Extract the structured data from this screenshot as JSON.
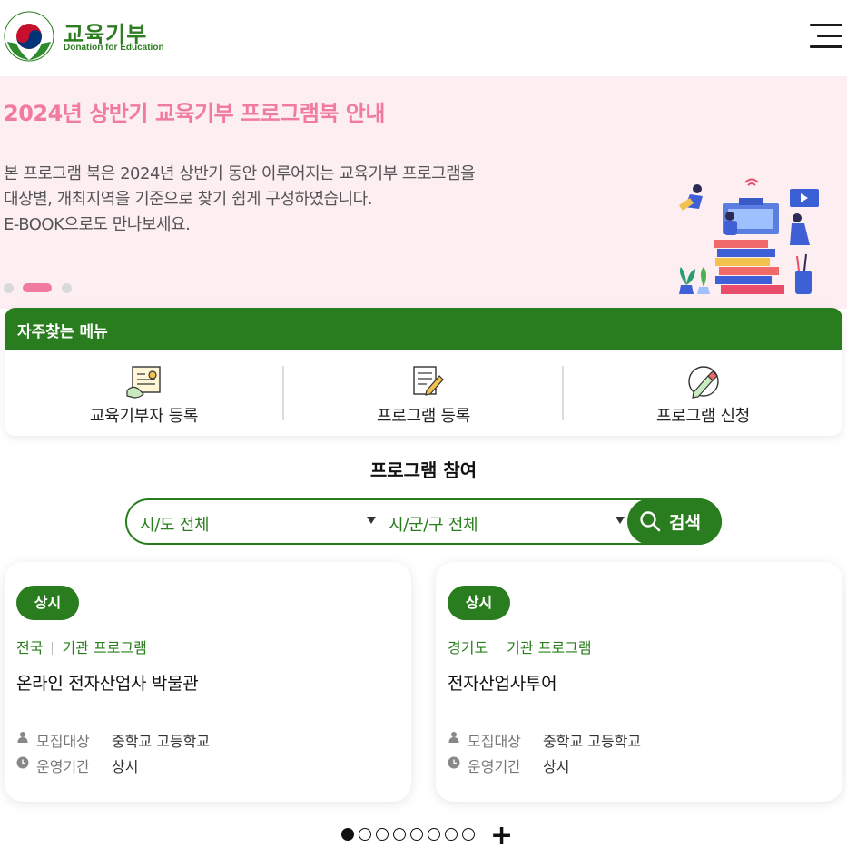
{
  "header": {
    "title": "교육기부",
    "subtitle": "Donation for Education",
    "logo_ring_text": "Donation for Education",
    "menu_icon": "hamburger-menu-icon"
  },
  "banner": {
    "title": "2024년 상반기 교육기부 프로그램북 안내",
    "description": [
      "본 프로그램 북은 2024년 상반기 동안 이루어지는 교육기부 프로그램을",
      "대상별, 개최지역을 기준으로 찾기 쉽게 구성하였습니다.",
      "E-BOOK으로도 만나보세요."
    ],
    "slide_count": 3,
    "active_slide": 2,
    "colors": {
      "background": "#fdeef1",
      "title": "#f07aa0",
      "dot_active": "#f07aa0"
    }
  },
  "quick_menu": {
    "title": "자주찾는 메뉴",
    "items": [
      {
        "label": "교육기부자 등록",
        "icon": "id-card-hand-icon"
      },
      {
        "label": "프로그램 등록",
        "icon": "document-pencil-icon"
      },
      {
        "label": "프로그램 신청",
        "icon": "pen-circle-icon"
      }
    ]
  },
  "program": {
    "title": "프로그램 참여",
    "region_select": "시/도 전체",
    "district_select": "시/군/구 전체",
    "search_label": "검색",
    "search_icon": "search-icon"
  },
  "cards": [
    {
      "badge": "상시",
      "region": "전국",
      "type": "기관 프로그램",
      "title": "온라인 전자산업사 박물관",
      "target_label": "모집대상",
      "target_value": "중학교 고등학교",
      "period_label": "운영기간",
      "period_value": "상시"
    },
    {
      "badge": "상시",
      "region": "경기도",
      "type": "기관 프로그램",
      "title": "전자산업사투어",
      "target_label": "모집대상",
      "target_value": "중학교 고등학교",
      "period_label": "운영기간",
      "period_value": "상시"
    }
  ],
  "pager": {
    "page_count": 8,
    "active_page": 1,
    "more_label": "+"
  },
  "colors": {
    "brand_green": "#2a7d1e"
  }
}
